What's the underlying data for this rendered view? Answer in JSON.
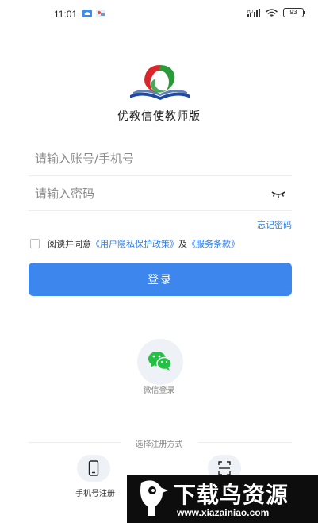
{
  "status_bar": {
    "time": "11:01",
    "battery": "93",
    "icons": [
      "cloud-app-icon",
      "map-app-icon",
      "hd-signal-icon",
      "wifi-icon",
      "battery-icon"
    ]
  },
  "app": {
    "title": "优教信使教师版"
  },
  "login_form": {
    "account_placeholder": "请输入账号/手机号",
    "password_placeholder": "请输入密码",
    "forgot_password": "忘记密码",
    "agreement_prefix": "阅读并同意",
    "privacy_policy": "《用户隐私保护政策》",
    "agreement_and": "及",
    "service_terms": "《服务条款》",
    "login_button": "登录"
  },
  "wechat": {
    "label": "微信登录"
  },
  "register": {
    "title": "选择注册方式",
    "phone_label": "手机号注册"
  },
  "watermark": {
    "text": "下载鸟资源",
    "url": "www.xiazainiao.com"
  },
  "colors": {
    "accent": "#3d86ed",
    "link": "#2b7de9",
    "wechat_green": "#22c043",
    "logo_red": "#d8262a",
    "logo_green": "#2a9a3a",
    "logo_blue": "#1f4aa0"
  }
}
